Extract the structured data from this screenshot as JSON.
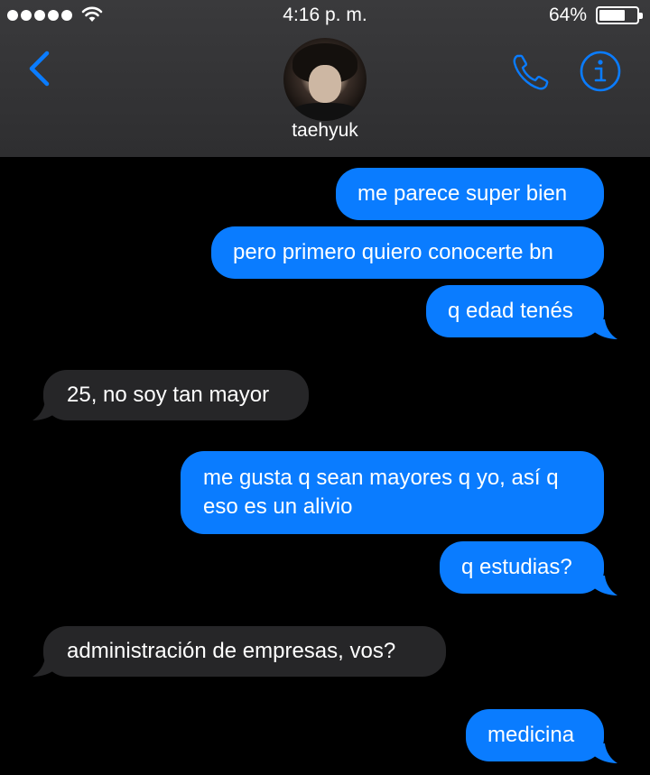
{
  "status_bar": {
    "time": "4:16 p. m.",
    "battery": "64%",
    "battery_level": 0.64,
    "signal_bars": 5
  },
  "header": {
    "contact_name": "taehyuk",
    "back_icon": "chevron-left-icon",
    "call_icon": "phone-icon",
    "info_icon": "info-icon"
  },
  "colors": {
    "accent": "#0a7cff",
    "sent_bubble": "#0a7cff",
    "received_bubble": "#262628",
    "header_bg": "#333335",
    "background": "#000000"
  },
  "messages": [
    {
      "direction": "sent",
      "text": "me parece super bien"
    },
    {
      "direction": "sent",
      "text": "pero primero quiero conocerte bn"
    },
    {
      "direction": "sent",
      "text": "q edad tenés"
    },
    {
      "direction": "received",
      "text": "25, no soy tan mayor"
    },
    {
      "direction": "sent",
      "lines": [
        "me gusta q sean mayores q yo, así q",
        "eso es un alivio"
      ]
    },
    {
      "direction": "sent",
      "text": "q estudias?"
    },
    {
      "direction": "received",
      "text": "administración de empresas, vos?"
    },
    {
      "direction": "sent",
      "text": "medicina"
    }
  ]
}
